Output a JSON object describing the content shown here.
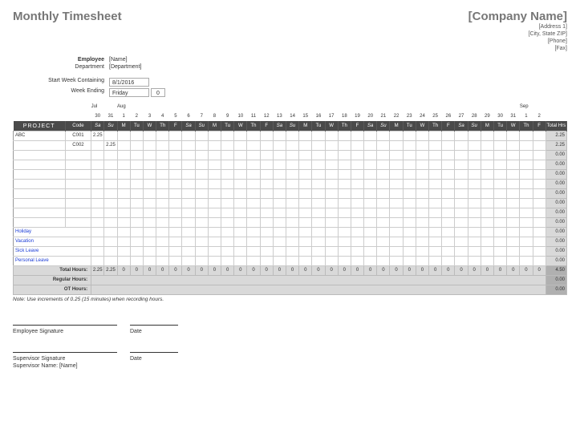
{
  "title": "Monthly Timesheet",
  "company": {
    "name": "[Company Name]",
    "addr1": "[Address 1]",
    "addr2": "[City, State  ZIP]",
    "phone": "[Phone]",
    "fax": "[Fax]"
  },
  "labels": {
    "employee": "Employee",
    "department": "Department",
    "startWeek": "Start Week Containing",
    "weekEnding": "Week Ending"
  },
  "info": {
    "employee": "[Name]",
    "department": "[Department]",
    "startWeek": "8/1/2016",
    "weekEnding": "Friday",
    "weekEndingNum": "0"
  },
  "months": {
    "jul": "Jul",
    "aug": "Aug",
    "sep": "Sep"
  },
  "dates": [
    "30",
    "31",
    "1",
    "2",
    "3",
    "4",
    "5",
    "6",
    "7",
    "8",
    "9",
    "10",
    "11",
    "12",
    "13",
    "14",
    "15",
    "16",
    "17",
    "18",
    "19",
    "20",
    "21",
    "22",
    "23",
    "24",
    "25",
    "26",
    "27",
    "28",
    "29",
    "30",
    "31",
    "1",
    "2"
  ],
  "days": [
    "Sa",
    "Su",
    "M",
    "Tu",
    "W",
    "Th",
    "F",
    "Sa",
    "Su",
    "M",
    "Tu",
    "W",
    "Th",
    "F",
    "Sa",
    "Su",
    "M",
    "Tu",
    "W",
    "Th",
    "F",
    "Sa",
    "Su",
    "M",
    "Tu",
    "W",
    "Th",
    "F",
    "Sa",
    "Su",
    "M",
    "Tu",
    "W",
    "Th",
    "F"
  ],
  "headers": {
    "project": "PROJECT",
    "code": "Code",
    "total": "Total Hrs"
  },
  "rows": [
    {
      "project": "ABC",
      "code": "C001",
      "cells": [
        "2.25",
        "",
        "",
        "",
        "",
        "",
        "",
        "",
        "",
        "",
        "",
        "",
        "",
        "",
        "",
        "",
        "",
        "",
        "",
        "",
        "",
        "",
        "",
        "",
        "",
        "",
        "",
        "",
        "",
        "",
        "",
        "",
        "",
        "",
        ""
      ],
      "total": "2.25"
    },
    {
      "project": "",
      "code": "C002",
      "cells": [
        "",
        "2.25",
        "",
        "",
        "",
        "",
        "",
        "",
        "",
        "",
        "",
        "",
        "",
        "",
        "",
        "",
        "",
        "",
        "",
        "",
        "",
        "",
        "",
        "",
        "",
        "",
        "",
        "",
        "",
        "",
        "",
        "",
        "",
        "",
        ""
      ],
      "total": "2.25"
    },
    {
      "project": "",
      "code": "",
      "cells": [
        "",
        "",
        "",
        "",
        "",
        "",
        "",
        "",
        "",
        "",
        "",
        "",
        "",
        "",
        "",
        "",
        "",
        "",
        "",
        "",
        "",
        "",
        "",
        "",
        "",
        "",
        "",
        "",
        "",
        "",
        "",
        "",
        "",
        "",
        ""
      ],
      "total": "0.00"
    },
    {
      "project": "",
      "code": "",
      "cells": [
        "",
        "",
        "",
        "",
        "",
        "",
        "",
        "",
        "",
        "",
        "",
        "",
        "",
        "",
        "",
        "",
        "",
        "",
        "",
        "",
        "",
        "",
        "",
        "",
        "",
        "",
        "",
        "",
        "",
        "",
        "",
        "",
        "",
        "",
        ""
      ],
      "total": "0.00"
    },
    {
      "project": "",
      "code": "",
      "cells": [
        "",
        "",
        "",
        "",
        "",
        "",
        "",
        "",
        "",
        "",
        "",
        "",
        "",
        "",
        "",
        "",
        "",
        "",
        "",
        "",
        "",
        "",
        "",
        "",
        "",
        "",
        "",
        "",
        "",
        "",
        "",
        "",
        "",
        "",
        ""
      ],
      "total": "0.00"
    },
    {
      "project": "",
      "code": "",
      "cells": [
        "",
        "",
        "",
        "",
        "",
        "",
        "",
        "",
        "",
        "",
        "",
        "",
        "",
        "",
        "",
        "",
        "",
        "",
        "",
        "",
        "",
        "",
        "",
        "",
        "",
        "",
        "",
        "",
        "",
        "",
        "",
        "",
        "",
        "",
        ""
      ],
      "total": "0.00"
    },
    {
      "project": "",
      "code": "",
      "cells": [
        "",
        "",
        "",
        "",
        "",
        "",
        "",
        "",
        "",
        "",
        "",
        "",
        "",
        "",
        "",
        "",
        "",
        "",
        "",
        "",
        "",
        "",
        "",
        "",
        "",
        "",
        "",
        "",
        "",
        "",
        "",
        "",
        "",
        "",
        ""
      ],
      "total": "0.00"
    },
    {
      "project": "",
      "code": "",
      "cells": [
        "",
        "",
        "",
        "",
        "",
        "",
        "",
        "",
        "",
        "",
        "",
        "",
        "",
        "",
        "",
        "",
        "",
        "",
        "",
        "",
        "",
        "",
        "",
        "",
        "",
        "",
        "",
        "",
        "",
        "",
        "",
        "",
        "",
        "",
        ""
      ],
      "total": "0.00"
    },
    {
      "project": "",
      "code": "",
      "cells": [
        "",
        "",
        "",
        "",
        "",
        "",
        "",
        "",
        "",
        "",
        "",
        "",
        "",
        "",
        "",
        "",
        "",
        "",
        "",
        "",
        "",
        "",
        "",
        "",
        "",
        "",
        "",
        "",
        "",
        "",
        "",
        "",
        "",
        "",
        ""
      ],
      "total": "0.00"
    },
    {
      "project": "",
      "code": "",
      "cells": [
        "",
        "",
        "",
        "",
        "",
        "",
        "",
        "",
        "",
        "",
        "",
        "",
        "",
        "",
        "",
        "",
        "",
        "",
        "",
        "",
        "",
        "",
        "",
        "",
        "",
        "",
        "",
        "",
        "",
        "",
        "",
        "",
        "",
        "",
        ""
      ],
      "total": "0.00"
    }
  ],
  "leaveRows": [
    {
      "project": "Holiday",
      "total": "0.00"
    },
    {
      "project": "Vacation",
      "total": "0.00"
    },
    {
      "project": "Sick Leave",
      "total": "0.00"
    },
    {
      "project": "Personal Leave",
      "total": "0.00"
    }
  ],
  "totals": {
    "totalHoursLabel": "Total Hours:",
    "regularLabel": "Regular Hours:",
    "otLabel": "OT Hours:",
    "row": [
      "2.25",
      "2.25",
      "0",
      "0",
      "0",
      "0",
      "0",
      "0",
      "0",
      "0",
      "0",
      "0",
      "0",
      "0",
      "0",
      "0",
      "0",
      "0",
      "0",
      "0",
      "0",
      "0",
      "0",
      "0",
      "0",
      "0",
      "0",
      "0",
      "0",
      "0",
      "0",
      "0",
      "0",
      "0",
      "0"
    ],
    "grand": "4.50",
    "regGrand": "0.00",
    "otGrand": "0.00"
  },
  "note": "Note: Use increments of 0.25 (15 minutes) when recording hours.",
  "sig": {
    "emp": "Employee Signature",
    "date": "Date",
    "sup": "Supervisor Signature",
    "supName": "Supervisor Name: [Name]"
  }
}
